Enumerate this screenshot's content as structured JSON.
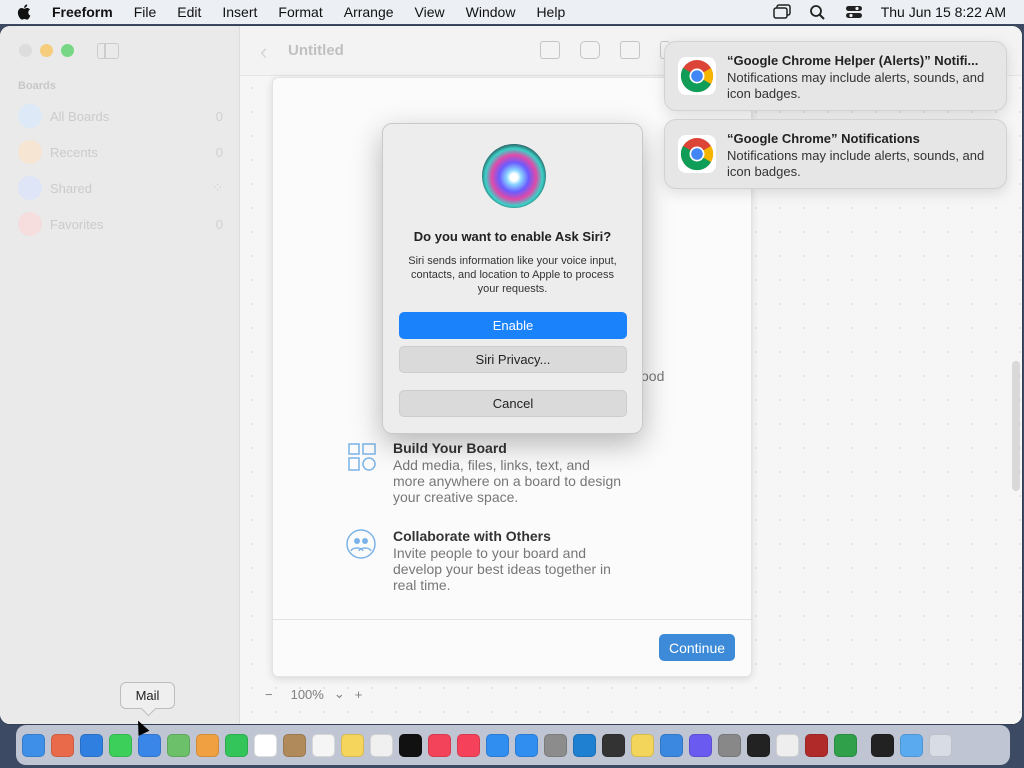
{
  "menubar": {
    "app_name": "Freeform",
    "items": [
      "File",
      "Edit",
      "Insert",
      "Format",
      "Arrange",
      "View",
      "Window",
      "Help"
    ],
    "clock": "Thu Jun 15  8:22 AM"
  },
  "sidebar": {
    "section": "Boards",
    "items": [
      {
        "label": "All Boards",
        "count": "0",
        "color": "#5aa9f5"
      },
      {
        "label": "Recents",
        "count": "0",
        "color": "#f4a94b"
      },
      {
        "label": "Shared",
        "count": "",
        "color": "#5b8ff5"
      },
      {
        "label": "Favorites",
        "count": "0",
        "color": "#f0606b"
      }
    ]
  },
  "toolbar": {
    "title": "Untitled"
  },
  "welcome": {
    "partial_text": "ood",
    "features": [
      {
        "title": "Build Your Board",
        "desc": "Add media, files, links, text, and more anywhere on a board to design your creative space."
      },
      {
        "title": "Collaborate with Others",
        "desc": "Invite people to your board and develop your best ideas together in real time."
      }
    ],
    "continue_label": "Continue"
  },
  "zoom": {
    "minus": "−",
    "value": "100%",
    "chevron": "⌄",
    "plus": "+"
  },
  "siri_dialog": {
    "title": "Do you want to enable Ask Siri?",
    "body": "Siri sends information like your voice input, contacts, and location to Apple to process your requests.",
    "enable_label": "Enable",
    "privacy_label": "Siri Privacy...",
    "cancel_label": "Cancel"
  },
  "notifications": [
    {
      "title": "“Google Chrome Helper (Alerts)” Notifi...",
      "body": "Notifications may include alerts, sounds, and icon badges."
    },
    {
      "title": "“Google Chrome” Notifications",
      "body": "Notifications may include alerts, sounds, and icon badges."
    }
  ],
  "dock": {
    "tooltip": "Mail",
    "apps": [
      {
        "name": "finder-icon",
        "color": "#3d8fe8"
      },
      {
        "name": "launchpad-icon",
        "color": "#e96a4a"
      },
      {
        "name": "safari-icon",
        "color": "#2f7fe0"
      },
      {
        "name": "messages-icon",
        "color": "#3ccf5a"
      },
      {
        "name": "mail-icon",
        "color": "#3a86e8"
      },
      {
        "name": "maps-icon",
        "color": "#6cc06a"
      },
      {
        "name": "photos-icon",
        "color": "#f0a040"
      },
      {
        "name": "facetime-icon",
        "color": "#33c45a"
      },
      {
        "name": "calendar-icon",
        "color": "#ffffff"
      },
      {
        "name": "contacts-icon",
        "color": "#b08a5a"
      },
      {
        "name": "reminders-icon",
        "color": "#f5f5f5"
      },
      {
        "name": "notes-icon",
        "color": "#f6d55c"
      },
      {
        "name": "freeform-icon",
        "color": "#f0f0f0"
      },
      {
        "name": "tv-icon",
        "color": "#111111"
      },
      {
        "name": "music-icon",
        "color": "#f3435a"
      },
      {
        "name": "news-icon",
        "color": "#f5425a"
      },
      {
        "name": "keynote-icon",
        "color": "#2f8ef0"
      },
      {
        "name": "app-store-icon",
        "color": "#2f8ef0"
      },
      {
        "name": "system-settings-icon",
        "color": "#8c8c8c"
      },
      {
        "name": "vscode-icon",
        "color": "#1f7fd0"
      },
      {
        "name": "terminal-icon",
        "color": "#333333"
      },
      {
        "name": "stickies-icon",
        "color": "#f3d55c"
      },
      {
        "name": "cloud-icon",
        "color": "#3a88e0"
      },
      {
        "name": "shortcuts-icon",
        "color": "#6a5af0"
      },
      {
        "name": "font-book-icon",
        "color": "#888888"
      },
      {
        "name": "chess-icon",
        "color": "#222222"
      },
      {
        "name": "script-editor-icon",
        "color": "#eeeeee"
      },
      {
        "name": "dictionary-icon",
        "color": "#b02a2a"
      },
      {
        "name": "chrome-icon",
        "color": "#30a04a"
      },
      {
        "name": "activity-monitor-icon",
        "color": "#222222"
      },
      {
        "name": "downloads-folder-icon",
        "color": "#5aaaf0"
      },
      {
        "name": "trash-icon",
        "color": "#d8dde5"
      }
    ]
  }
}
